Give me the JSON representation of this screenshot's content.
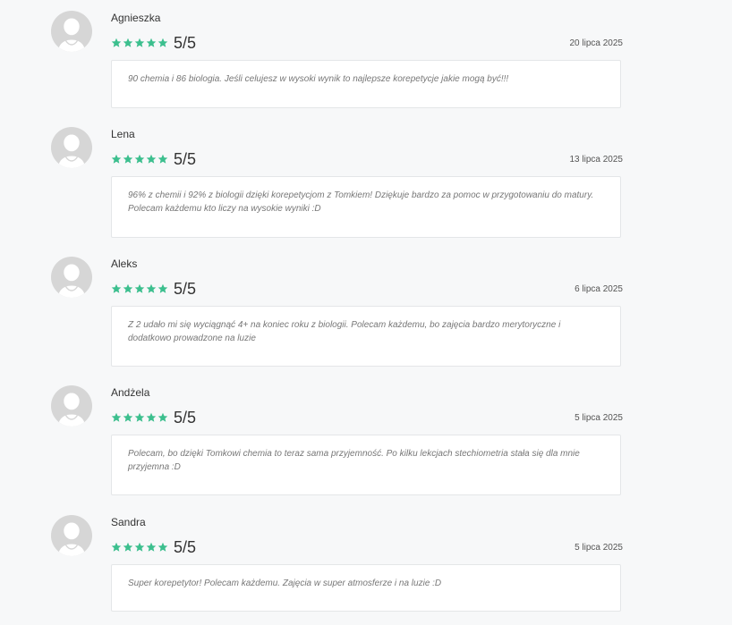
{
  "colors": {
    "star": "#3cbf8e",
    "avatar": "#d6d6d6",
    "background": "#f7f8f9"
  },
  "icons": {
    "avatar": "user-avatar-icon",
    "star": "star-icon"
  },
  "reviews": [
    {
      "name": "Agnieszka",
      "stars": 5,
      "score": "5/5",
      "date": "20 lipca 2025",
      "comment": "90 chemia i 86 biologia. Jeśli celujesz w wysoki wynik to najlepsze korepetycje jakie mogą być!!!"
    },
    {
      "name": "Lena",
      "stars": 5,
      "score": "5/5",
      "date": "13 lipca 2025",
      "comment": "96% z chemii i 92% z biologii dzięki korepetycjom z Tomkiem! Dziękuje bardzo za pomoc w przygotowaniu do matury. Polecam każdemu kto liczy na wysokie wyniki :D"
    },
    {
      "name": "Aleks",
      "stars": 5,
      "score": "5/5",
      "date": "6 lipca 2025",
      "comment": "Z 2 udało mi się wyciągnąć 4+ na koniec roku z biologii. Polecam każdemu, bo zajęcia bardzo merytoryczne i dodatkowo prowadzone na luzie"
    },
    {
      "name": "Andżela",
      "stars": 5,
      "score": "5/5",
      "date": "5 lipca 2025",
      "comment": "Polecam, bo dzięki Tomkowi chemia to teraz sama przyjemność. Po kilku lekcjach stechiometria stała się dla mnie przyjemna :D"
    },
    {
      "name": "Sandra",
      "stars": 5,
      "score": "5/5",
      "date": "5 lipca 2025",
      "comment": "Super korepetytor! Polecam każdemu. Zajęcia w super atmosferze i na luzie :D"
    }
  ]
}
